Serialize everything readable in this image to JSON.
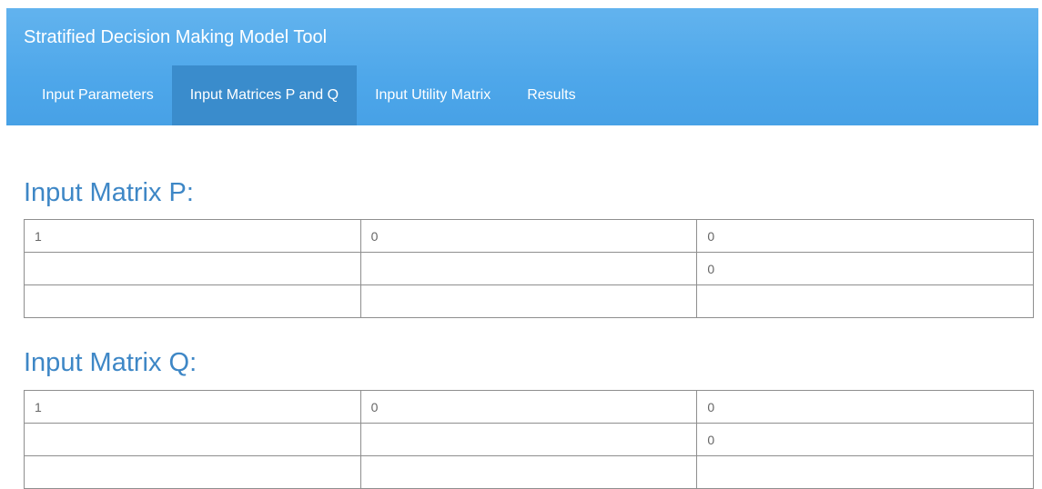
{
  "navbar": {
    "title": "Stratified Decision Making Model Tool",
    "tabs": [
      {
        "label": "Input Parameters",
        "active": false
      },
      {
        "label": "Input Matrices P and Q",
        "active": true
      },
      {
        "label": "Input Utility Matrix",
        "active": false
      },
      {
        "label": "Results",
        "active": false
      }
    ],
    "colors": {
      "bar": "#4ea7ea",
      "active_tab": "#3a8ccc",
      "text": "#ffffff"
    }
  },
  "matrix_p": {
    "title": "Input Matrix P:",
    "rows": [
      [
        "1",
        "0",
        "0"
      ],
      [
        "",
        "",
        "0"
      ],
      [
        "",
        "",
        ""
      ]
    ]
  },
  "matrix_q": {
    "title": "Input Matrix Q:",
    "rows": [
      [
        "1",
        "0",
        "0"
      ],
      [
        "",
        "",
        "0"
      ],
      [
        "",
        "",
        ""
      ]
    ]
  },
  "colors": {
    "heading": "#3e87c6",
    "cell_border": "#8e8e8e",
    "cell_text": "#666666"
  }
}
